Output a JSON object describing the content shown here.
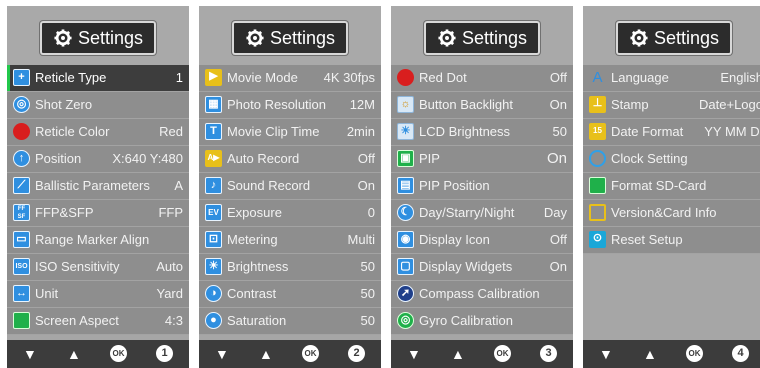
{
  "title": "Settings",
  "footer": {
    "down": "▼",
    "up": "▲",
    "ok": "OK"
  },
  "pages": [
    {
      "number": "1",
      "items": [
        {
          "label": "Reticle Type",
          "value": "1",
          "icon": "reticle-type-icon",
          "selected": true
        },
        {
          "label": "Shot Zero",
          "value": "",
          "icon": "shot-zero-icon"
        },
        {
          "label": "Reticle Color",
          "value": "Red",
          "icon": "reticle-color-icon"
        },
        {
          "label": "Position",
          "value": "X:640 Y:480",
          "icon": "position-icon"
        },
        {
          "label": "Ballistic Parameters",
          "value": "A",
          "icon": "ballistic-icon"
        },
        {
          "label": "FFP&SFP",
          "value": "FFP",
          "icon": "ffp-sfp-icon"
        },
        {
          "label": "Range Marker Align",
          "value": "",
          "icon": "range-marker-icon"
        },
        {
          "label": "ISO Sensitivity",
          "value": "Auto",
          "icon": "iso-icon"
        },
        {
          "label": "Unit",
          "value": "Yard",
          "icon": "unit-icon"
        },
        {
          "label": "Screen Aspect",
          "value": "4:3",
          "icon": "screen-aspect-icon"
        }
      ]
    },
    {
      "number": "2",
      "items": [
        {
          "label": "Movie Mode",
          "value": "4K 30fps",
          "icon": "movie-mode-icon"
        },
        {
          "label": "Photo Resolution",
          "value": "12M",
          "icon": "photo-resolution-icon"
        },
        {
          "label": "Movie Clip Time",
          "value": "2min",
          "icon": "movie-clip-time-icon"
        },
        {
          "label": "Auto Record",
          "value": "Off",
          "icon": "auto-record-icon"
        },
        {
          "label": "Sound Record",
          "value": "On",
          "icon": "sound-record-icon"
        },
        {
          "label": "Exposure",
          "value": "0",
          "icon": "exposure-icon"
        },
        {
          "label": "Metering",
          "value": "Multi",
          "icon": "metering-icon"
        },
        {
          "label": "Brightness",
          "value": "50",
          "icon": "brightness-icon"
        },
        {
          "label": "Contrast",
          "value": "50",
          "icon": "contrast-icon"
        },
        {
          "label": "Saturation",
          "value": "50",
          "icon": "saturation-icon"
        }
      ]
    },
    {
      "number": "3",
      "items": [
        {
          "label": "Red Dot",
          "value": "Off",
          "icon": "red-dot-icon"
        },
        {
          "label": "Button Backlight",
          "value": "On",
          "icon": "button-backlight-icon"
        },
        {
          "label": "LCD Brightness",
          "value": "50",
          "icon": "lcd-brightness-icon"
        },
        {
          "label": "PIP",
          "value": "On",
          "icon": "pip-icon"
        },
        {
          "label": "PIP Position",
          "value": "",
          "icon": "pip-position-icon"
        },
        {
          "label": "Day/Starry/Night",
          "value": "Day",
          "icon": "day-night-icon"
        },
        {
          "label": "Display Icon",
          "value": "Off",
          "icon": "display-icon-icon"
        },
        {
          "label": "Display Widgets",
          "value": "On",
          "icon": "display-widgets-icon"
        },
        {
          "label": "Compass Calibration",
          "value": "",
          "icon": "compass-icon"
        },
        {
          "label": "Gyro Calibration",
          "value": "",
          "icon": "gyro-icon"
        }
      ]
    },
    {
      "number": "4",
      "items": [
        {
          "label": "Language",
          "value": "English",
          "icon": "language-icon"
        },
        {
          "label": "Stamp",
          "value": "Date+Logo",
          "icon": "stamp-icon"
        },
        {
          "label": "Date Format",
          "value": "YY MM DD",
          "icon": "date-format-icon"
        },
        {
          "label": "Clock Setting",
          "value": "",
          "icon": "clock-icon"
        },
        {
          "label": "Format SD-Card",
          "value": "",
          "icon": "sd-card-icon"
        },
        {
          "label": "Version&Card Info",
          "value": "",
          "icon": "version-icon"
        },
        {
          "label": "Reset Setup",
          "value": "",
          "icon": "reset-icon"
        }
      ]
    }
  ]
}
